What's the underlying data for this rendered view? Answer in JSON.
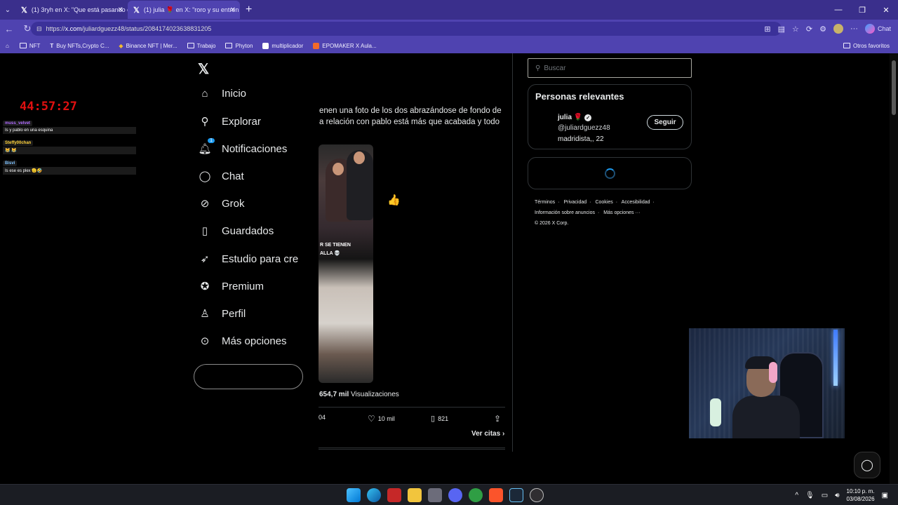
{
  "browser": {
    "tabs": [
      {
        "title": "(1) 3ryh en X: \"Que está pasando e",
        "active": false
      },
      {
        "title": "(1) julia 🌹 en X: \"roro y su entren",
        "active": true
      }
    ],
    "url_prefix": "https://",
    "url_host": "x.com",
    "url_path": "/juliardguezz48/status/2084174023638831205",
    "copilot_label": "Chat",
    "bookmarks": [
      {
        "label": "NFT",
        "icon": "folder-icon"
      },
      {
        "label": "Buy NFTs,Crypto C...",
        "icon": "t-logo-icon"
      },
      {
        "label": "Binance NFT | Mer...",
        "icon": "binance-icon"
      },
      {
        "label": "Trabajo",
        "icon": "folder-icon"
      },
      {
        "label": "Phyton",
        "icon": "folder-icon"
      },
      {
        "label": "multiplicador",
        "icon": "app-icon"
      },
      {
        "label": "EPOMAKER X Aula...",
        "icon": "app-icon"
      }
    ],
    "other_favorites": "Otros favoritos"
  },
  "stream_overlay": {
    "timer": "44:57:27",
    "chat": [
      {
        "name": "muss_velvet",
        "name_color": "#b06cff",
        "message": "Is y pablo en una esquina"
      },
      {
        "name": "Steffy00chan",
        "name_color": "#ffd23a",
        "message": "😹 😹"
      },
      {
        "name": "Bisvi",
        "name_color": "#7ec3ff",
        "message": "Is ese es plex 🫡🤣"
      }
    ],
    "second_line_emojis": "😹 😹"
  },
  "sidebar_nav": {
    "items": [
      {
        "label": "Inicio",
        "icon": "home-icon"
      },
      {
        "label": "Explorar",
        "icon": "search-icon"
      },
      {
        "label": "Notificaciones",
        "icon": "bell-icon",
        "badge": "1"
      },
      {
        "label": "Chat",
        "icon": "chat-icon"
      },
      {
        "label": "Grok",
        "icon": "grok-icon"
      },
      {
        "label": "Guardados",
        "icon": "bookmark-icon"
      },
      {
        "label": "Estudio para cre",
        "icon": "rocket-icon"
      },
      {
        "label": "Premium",
        "icon": "verified-icon"
      },
      {
        "label": "Perfil",
        "icon": "person-icon"
      },
      {
        "label": "Más opciones",
        "icon": "more-icon"
      }
    ]
  },
  "tweet": {
    "text_line1": "enen una foto de los dos abrazándose de fondo de",
    "text_line2": "a relación con pablo está más que acabada y todo",
    "media_caption_line1": "R SE TIENEN",
    "media_caption_line2": "ALLA 💀",
    "emoji": "👍",
    "views_count": "654,7 mil",
    "views_label": "Visualizaciones",
    "retweets": "04",
    "likes": "10 mil",
    "bookmarks": "821",
    "quotes_link": "Ver citas"
  },
  "right_sidebar": {
    "search_placeholder": "Buscar",
    "relevant_title": "Personas relevantes",
    "user_name": "julia 🌹",
    "user_handle": "@juliardguezz48",
    "user_bio": "madridista,, 22",
    "follow_label": "Seguir",
    "footer_links": [
      "Términos",
      "Privacidad",
      "Cookies",
      "Accesibilidad",
      "Información sobre anuncios",
      "Más opciones ···"
    ],
    "copyright": "© 2026 X Corp."
  },
  "taskbar": {
    "time": "10:10 p. m.",
    "date": "03/08/2026"
  }
}
